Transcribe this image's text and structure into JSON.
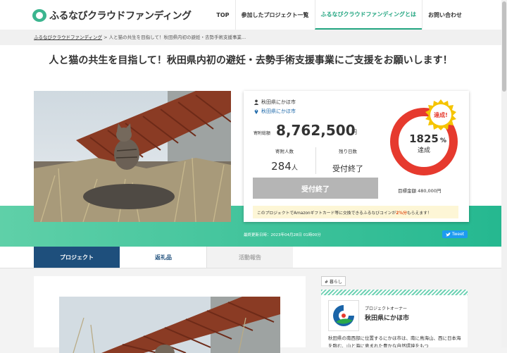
{
  "header": {
    "logo_text": "ふるなびクラウドファンディング",
    "nav": [
      "TOP",
      "参加したプロジェクト一覧",
      "ふるなびクラウドファンディングとは",
      "お問い合わせ"
    ]
  },
  "breadcrumb": {
    "home": "ふるなびクラウドファンディング",
    "separator": ">",
    "current": "人と猫の共生を目指して！秋田県内初の避妊・去勢手術支援事業..."
  },
  "project": {
    "title": "人と猫の共生を目指して！秋田県内初の避妊・去勢手術支援事業にご支援をお願いします！",
    "owner": "秋田県にかほ市",
    "location": "秋田県にかほ市",
    "donation_label": "寄附総額",
    "donation_amount": "8,762,500",
    "donation_unit": "円",
    "supporters_label": "寄附人数",
    "supporters_value": "284",
    "supporters_unit": "人",
    "remaining_label": "残り日数",
    "remaining_value": "受付終了",
    "button_label": "受付終了",
    "badge": "達成!",
    "percent": "1825",
    "percent_sign": "%",
    "achieved_label": "達成",
    "goal_text": "目標金額 480,000円",
    "notice_pre": "このプロジェクトでAmazonギフトカード等に交換できるふるなびコインが",
    "notice_highlight": "2%分",
    "notice_post": "もらえます！",
    "updated": "最終更新日時：2023年04月28日 01時00分",
    "tweet": "Tweet"
  },
  "tabs": [
    "プロジェクト",
    "返礼品",
    "活動報告"
  ],
  "sidebar": {
    "tag": "# 暮らし",
    "owner_role": "プロジェクトオーナー",
    "owner_name": "秋田県にかほ市",
    "owner_desc": "秋田県の南西部に位置するにかほ市は、南に鳥海山、西に日本海を臨む、山と海に恵まれた豊かな自然環境をもつ"
  },
  "colors": {
    "accent": "#22a580",
    "tab_active": "#1e4f7c",
    "ring_red": "#e63a2e",
    "badge_gold": "#f5c400"
  }
}
